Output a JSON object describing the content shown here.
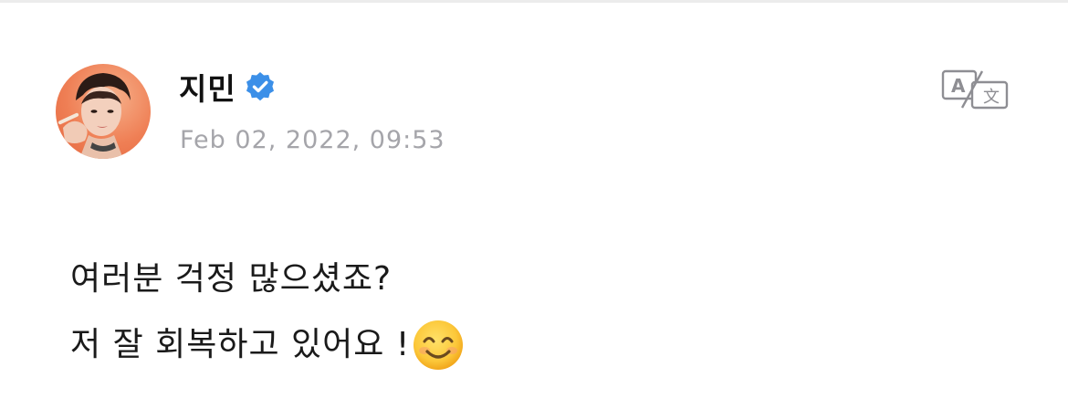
{
  "post": {
    "author": {
      "name": "지민",
      "verified": true,
      "avatar_icon": "avatar-portrait",
      "badge_color": "#3b8fe8"
    },
    "timestamp": "Feb 02, 2022, 09:53",
    "translate_icon": "translate-icon",
    "body": {
      "line1": "여러분 걱정 많으셨죠?",
      "line2": "저 잘 회복하고 있어요 !",
      "emoji": "smiling-face-emoji"
    }
  },
  "colors": {
    "timestamp": "#a5a5aa",
    "text": "#1a1a1a",
    "icon_gray": "#8e8e93",
    "avatar_bg": "#ef7f55"
  }
}
